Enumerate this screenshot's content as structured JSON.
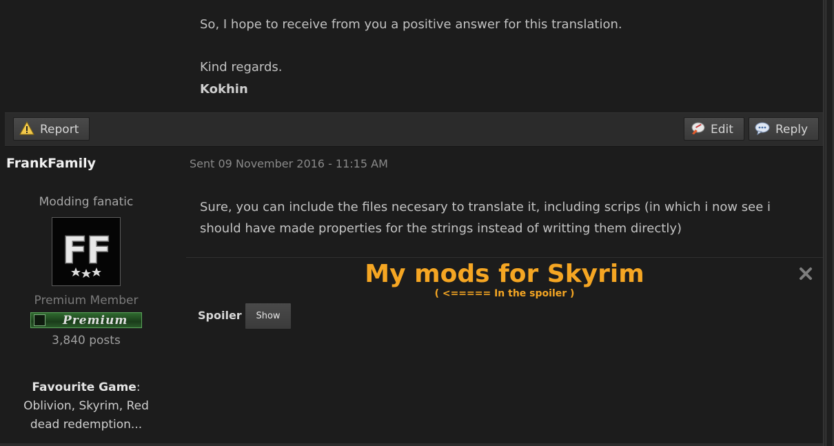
{
  "previous_post": {
    "line1": "So, I hope to receive from you a positive answer for this translation.",
    "closing": "Kind regards.",
    "signature": "Kokhin"
  },
  "action_bar": {
    "report_label": "Report",
    "edit_label": "Edit",
    "reply_label": "Reply",
    "icons": {
      "report": "warning-icon",
      "edit": "edit-icon",
      "reply": "reply-bubble-icon"
    }
  },
  "author": {
    "name": "FrankFamily",
    "title": "Modding fanatic",
    "avatar_text": "FF",
    "group": "Premium Member",
    "badge": "Premium",
    "posts": "3,840 posts",
    "fav_label": "Favourite Game",
    "fav_colon": ":",
    "fav_value": "Oblivion, Skyrim, Red dead redemption..."
  },
  "post": {
    "sent": "Sent 09 November 2016 - 11:15 AM",
    "body": "Sure, you can include the files necesary to translate it, including scrips (in which i now see i should have made properties for the strings instead of writting them directly)"
  },
  "signature": {
    "title": "My mods for Skyrim",
    "subtitle": "( <===== In the spoiler )",
    "spoiler_label": "Spoiler",
    "spoiler_button": "Show"
  },
  "colors": {
    "accent": "#f5a623",
    "background": "#1c1c1c",
    "bar": "#2b2b2b"
  }
}
